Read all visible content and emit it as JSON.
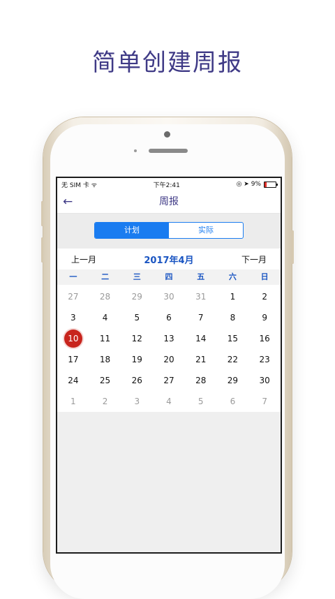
{
  "headline": "简单创建周报",
  "status_bar": {
    "carrier": "无 SIM 卡 ᯤ",
    "time": "下午2:41",
    "icons": "◎ ➤ 9%",
    "battery_percent": 9
  },
  "nav": {
    "back_icon": "←",
    "title": "周报"
  },
  "segments": [
    {
      "label": "计划",
      "active": true
    },
    {
      "label": "实际",
      "active": false
    }
  ],
  "calendar": {
    "prev_label": "上一月",
    "month_label": "2017年4月",
    "next_label": "下一月",
    "weekdays": [
      "一",
      "二",
      "三",
      "四",
      "五",
      "六",
      "日"
    ],
    "selected_day": "10",
    "days": [
      {
        "d": "27",
        "m": true
      },
      {
        "d": "28",
        "m": true
      },
      {
        "d": "29",
        "m": true
      },
      {
        "d": "30",
        "m": true
      },
      {
        "d": "31",
        "m": true
      },
      {
        "d": "1",
        "m": false
      },
      {
        "d": "2",
        "m": false
      },
      {
        "d": "3",
        "m": false
      },
      {
        "d": "4",
        "m": false
      },
      {
        "d": "5",
        "m": false
      },
      {
        "d": "6",
        "m": false
      },
      {
        "d": "7",
        "m": false
      },
      {
        "d": "8",
        "m": false
      },
      {
        "d": "9",
        "m": false
      },
      {
        "d": "10",
        "m": false
      },
      {
        "d": "11",
        "m": false
      },
      {
        "d": "12",
        "m": false
      },
      {
        "d": "13",
        "m": false
      },
      {
        "d": "14",
        "m": false
      },
      {
        "d": "15",
        "m": false
      },
      {
        "d": "16",
        "m": false
      },
      {
        "d": "17",
        "m": false
      },
      {
        "d": "18",
        "m": false
      },
      {
        "d": "19",
        "m": false
      },
      {
        "d": "20",
        "m": false
      },
      {
        "d": "21",
        "m": false
      },
      {
        "d": "22",
        "m": false
      },
      {
        "d": "23",
        "m": false
      },
      {
        "d": "24",
        "m": false
      },
      {
        "d": "25",
        "m": false
      },
      {
        "d": "26",
        "m": false
      },
      {
        "d": "27",
        "m": false
      },
      {
        "d": "28",
        "m": false
      },
      {
        "d": "29",
        "m": false
      },
      {
        "d": "30",
        "m": false
      },
      {
        "d": "1",
        "m": true
      },
      {
        "d": "2",
        "m": true
      },
      {
        "d": "3",
        "m": true
      },
      {
        "d": "4",
        "m": true
      },
      {
        "d": "5",
        "m": true
      },
      {
        "d": "6",
        "m": true
      },
      {
        "d": "7",
        "m": true
      }
    ]
  },
  "colors": {
    "headline": "#3f3a86",
    "accent": "#1a7cf0",
    "selected": "#c8241d"
  }
}
